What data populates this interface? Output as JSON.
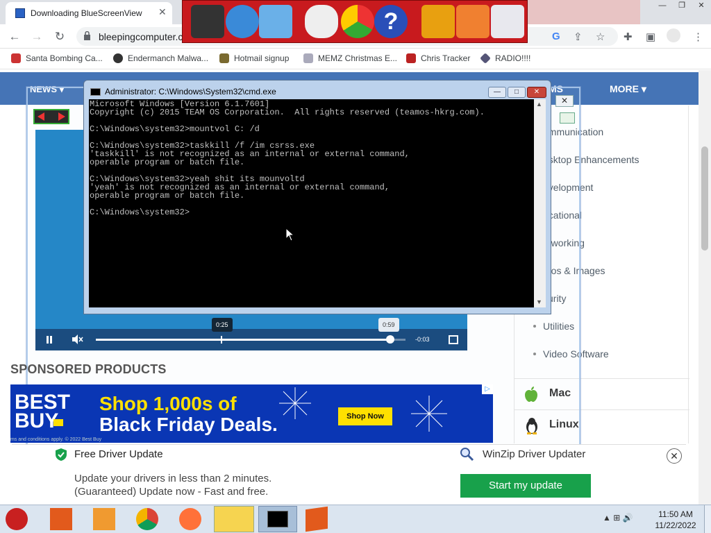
{
  "browser": {
    "tab_title": "Downloading BlueScreenView",
    "tab_close": "✕",
    "url": "bleepingcomputer.c",
    "window_controls": [
      "—",
      "❐",
      "✕"
    ],
    "bookmarks": [
      "Santa Bombing Ca...",
      "Endermanch Malwa...",
      "Hotmail signup",
      "MEMZ Christmas E...",
      "Chris Tracker",
      "RADIO!!!!"
    ]
  },
  "site": {
    "nav_left": "NEWS ▾",
    "nav_mid": "MS",
    "nav_right": "MORE ▾",
    "sponsored_heading": "SPONSORED PRODUCTS",
    "sidebar_items": [
      "ommunication",
      "esktop Enhancements",
      "evelopment",
      "ucational",
      "etworking",
      "otos & Images",
      "curity",
      "Utilities",
      "Video Software"
    ],
    "os_sections": [
      "Mac",
      "Linux"
    ]
  },
  "video": {
    "tooltip_current": "0:25",
    "tooltip_hover": "0:59",
    "remaining": "-0:03",
    "progress_fraction": 0.95
  },
  "ad": {
    "brand": "BEST BUY",
    "headline_1": "Shop 1,000s of",
    "headline_2": "Black Friday Deals.",
    "cta": "Shop Now",
    "fine_print": "ms and conditions apply. © 2022 Best Buy"
  },
  "cmd": {
    "title": "Administrator: C:\\Windows\\System32\\cmd.exe",
    "lines": [
      "Microsoft Windows [Version 6.1.7601]",
      "Copyright (c) 2015 TEAM OS Corporation.  All rights reserved (teamos-hkrg.com).",
      "",
      "C:\\Windows\\system32>mountvol C: /d",
      "",
      "C:\\Windows\\system32>taskkill /f /im csrss.exe",
      "'taskkill' is not recognized as an internal or external command,",
      "operable program or batch file.",
      "",
      "C:\\Windows\\system32>yeah shit its mounvoltd",
      "'yeah' is not recognized as an internal or external command,",
      "operable program or batch file.",
      "",
      "C:\\Windows\\system32>"
    ]
  },
  "driver_bar": {
    "title": "Free Driver Update",
    "line1": "Update your drivers in less than 2 minutes.",
    "line2": "(Guaranteed) Update now - Fast and free.",
    "winzip": "WinZip Driver Updater",
    "button": "Start my update",
    "close": "✕"
  },
  "taskbar": {
    "time": "11:50 AM",
    "date": "11/22/2022"
  },
  "colors": {
    "site_nav": "#4574b6",
    "video_blue": "#1d83c6",
    "ad_blue": "#0a36b4",
    "ad_yellow": "#ffe000",
    "cta_green": "#18a14b",
    "festive_red": "#c81a1e"
  }
}
